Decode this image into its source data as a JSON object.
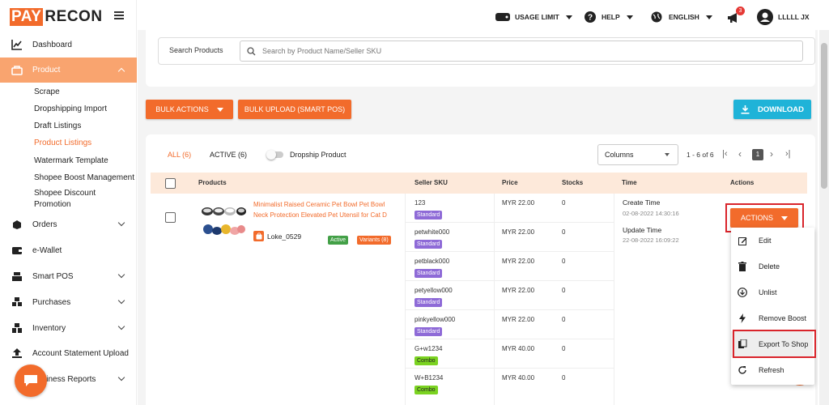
{
  "brand": {
    "part1": "PAY",
    "part2": "RECON"
  },
  "header": {
    "usage_limit": "USAGE LIMIT",
    "help": "HELP",
    "language": "ENGLISH",
    "notif_count": "3",
    "user": "LLLLL JX"
  },
  "sidebar": {
    "items": [
      {
        "label": "Dashboard"
      },
      {
        "label": "Product"
      },
      {
        "label": "Orders"
      },
      {
        "label": "e-Wallet"
      },
      {
        "label": "Smart POS"
      },
      {
        "label": "Purchases"
      },
      {
        "label": "Inventory"
      },
      {
        "label": "Account Statement Upload"
      },
      {
        "label": "Business Reports"
      }
    ],
    "product_sub": [
      {
        "label": "Scrape"
      },
      {
        "label": "Dropshipping Import"
      },
      {
        "label": "Draft Listings"
      },
      {
        "label": "Product Listings"
      },
      {
        "label": "Watermark Template"
      },
      {
        "label": "Shopee Boost Management"
      },
      {
        "label": "Shopee Discount"
      },
      {
        "label": "Promotion"
      }
    ]
  },
  "search": {
    "label": "Search Products",
    "placeholder": "Search by Product Name/Seller SKU"
  },
  "toolbar": {
    "bulk_actions": "BULK ACTIONS",
    "bulk_upload": "BULK UPLOAD (SMART POS)",
    "download": "DOWNLOAD"
  },
  "filters": {
    "all": "ALL (6)",
    "active": "ACTIVE (6)",
    "dropship": "Dropship Product",
    "columns": "Columns",
    "range": "1 - 6 of 6",
    "page": "1"
  },
  "table": {
    "headers": {
      "products": "Products",
      "sku": "Seller SKU",
      "price": "Price",
      "stocks": "Stocks",
      "time": "Time",
      "actions": "Actions"
    },
    "product": {
      "name_line1": "Minimalist Raised Ceramic Pet Bowl Pet Bowl",
      "name_line2": "Neck Protection Elevated Pet Utensil for Cat D",
      "shop": "Loke_0529",
      "status": "Active",
      "variants": "Variants (8)"
    },
    "variants": [
      {
        "sku": "123",
        "tag": "Standard",
        "price": "MYR 22.00",
        "stock": "0"
      },
      {
        "sku": "petwhite000",
        "tag": "Standard",
        "price": "MYR 22.00",
        "stock": "0"
      },
      {
        "sku": "petblack000",
        "tag": "Standard",
        "price": "MYR 22.00",
        "stock": "0"
      },
      {
        "sku": "petyellow000",
        "tag": "Standard",
        "price": "MYR 22.00",
        "stock": "0"
      },
      {
        "sku": "pinkyellow000",
        "tag": "Standard",
        "price": "MYR 22.00",
        "stock": "0"
      },
      {
        "sku": "G+w1234",
        "tag": "Combo",
        "price": "MYR 40.00",
        "stock": "0"
      },
      {
        "sku": "W+B1234",
        "tag": "Combo",
        "price": "MYR 40.00",
        "stock": "0"
      }
    ],
    "time": {
      "create_label": "Create Time",
      "create_value": "02-08-2022 14:30:16",
      "update_label": "Update Time",
      "update_value": "22-08-2022 16:09:22"
    },
    "actions_btn": "ACTIONS"
  },
  "actions_menu": [
    {
      "label": "Edit",
      "icon": "edit-icon"
    },
    {
      "label": "Delete",
      "icon": "trash-icon"
    },
    {
      "label": "Unlist",
      "icon": "unlist-icon"
    },
    {
      "label": "Remove Boost",
      "icon": "bolt-icon"
    },
    {
      "label": "Export To Shop",
      "icon": "copy-icon"
    },
    {
      "label": "Refresh",
      "icon": "refresh-icon"
    }
  ],
  "colors": {
    "accent": "#f26b2b",
    "teal": "#1fb3d8",
    "highlight": "#d9242b"
  }
}
